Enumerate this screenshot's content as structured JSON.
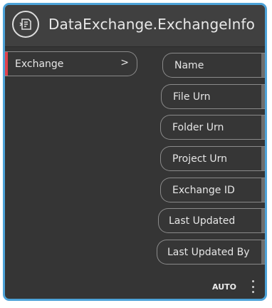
{
  "node": {
    "title": "DataExchange.ExchangeInfo",
    "icon": "data-exchange-icon",
    "accent_color": "#4da3d9",
    "background_color": "#353535"
  },
  "inputs": [
    {
      "label": "Exchange",
      "arrow": ">",
      "marker_color": "#e0414c"
    }
  ],
  "outputs": [
    {
      "label": "Name"
    },
    {
      "label": "File Urn"
    },
    {
      "label": "Folder Urn"
    },
    {
      "label": "Project Urn"
    },
    {
      "label": "Exchange ID"
    },
    {
      "label": "Last Updated"
    },
    {
      "label": "Last Updated By"
    }
  ],
  "footer": {
    "lacing": "AUTO",
    "menu_icon": "more-vertical-icon"
  }
}
